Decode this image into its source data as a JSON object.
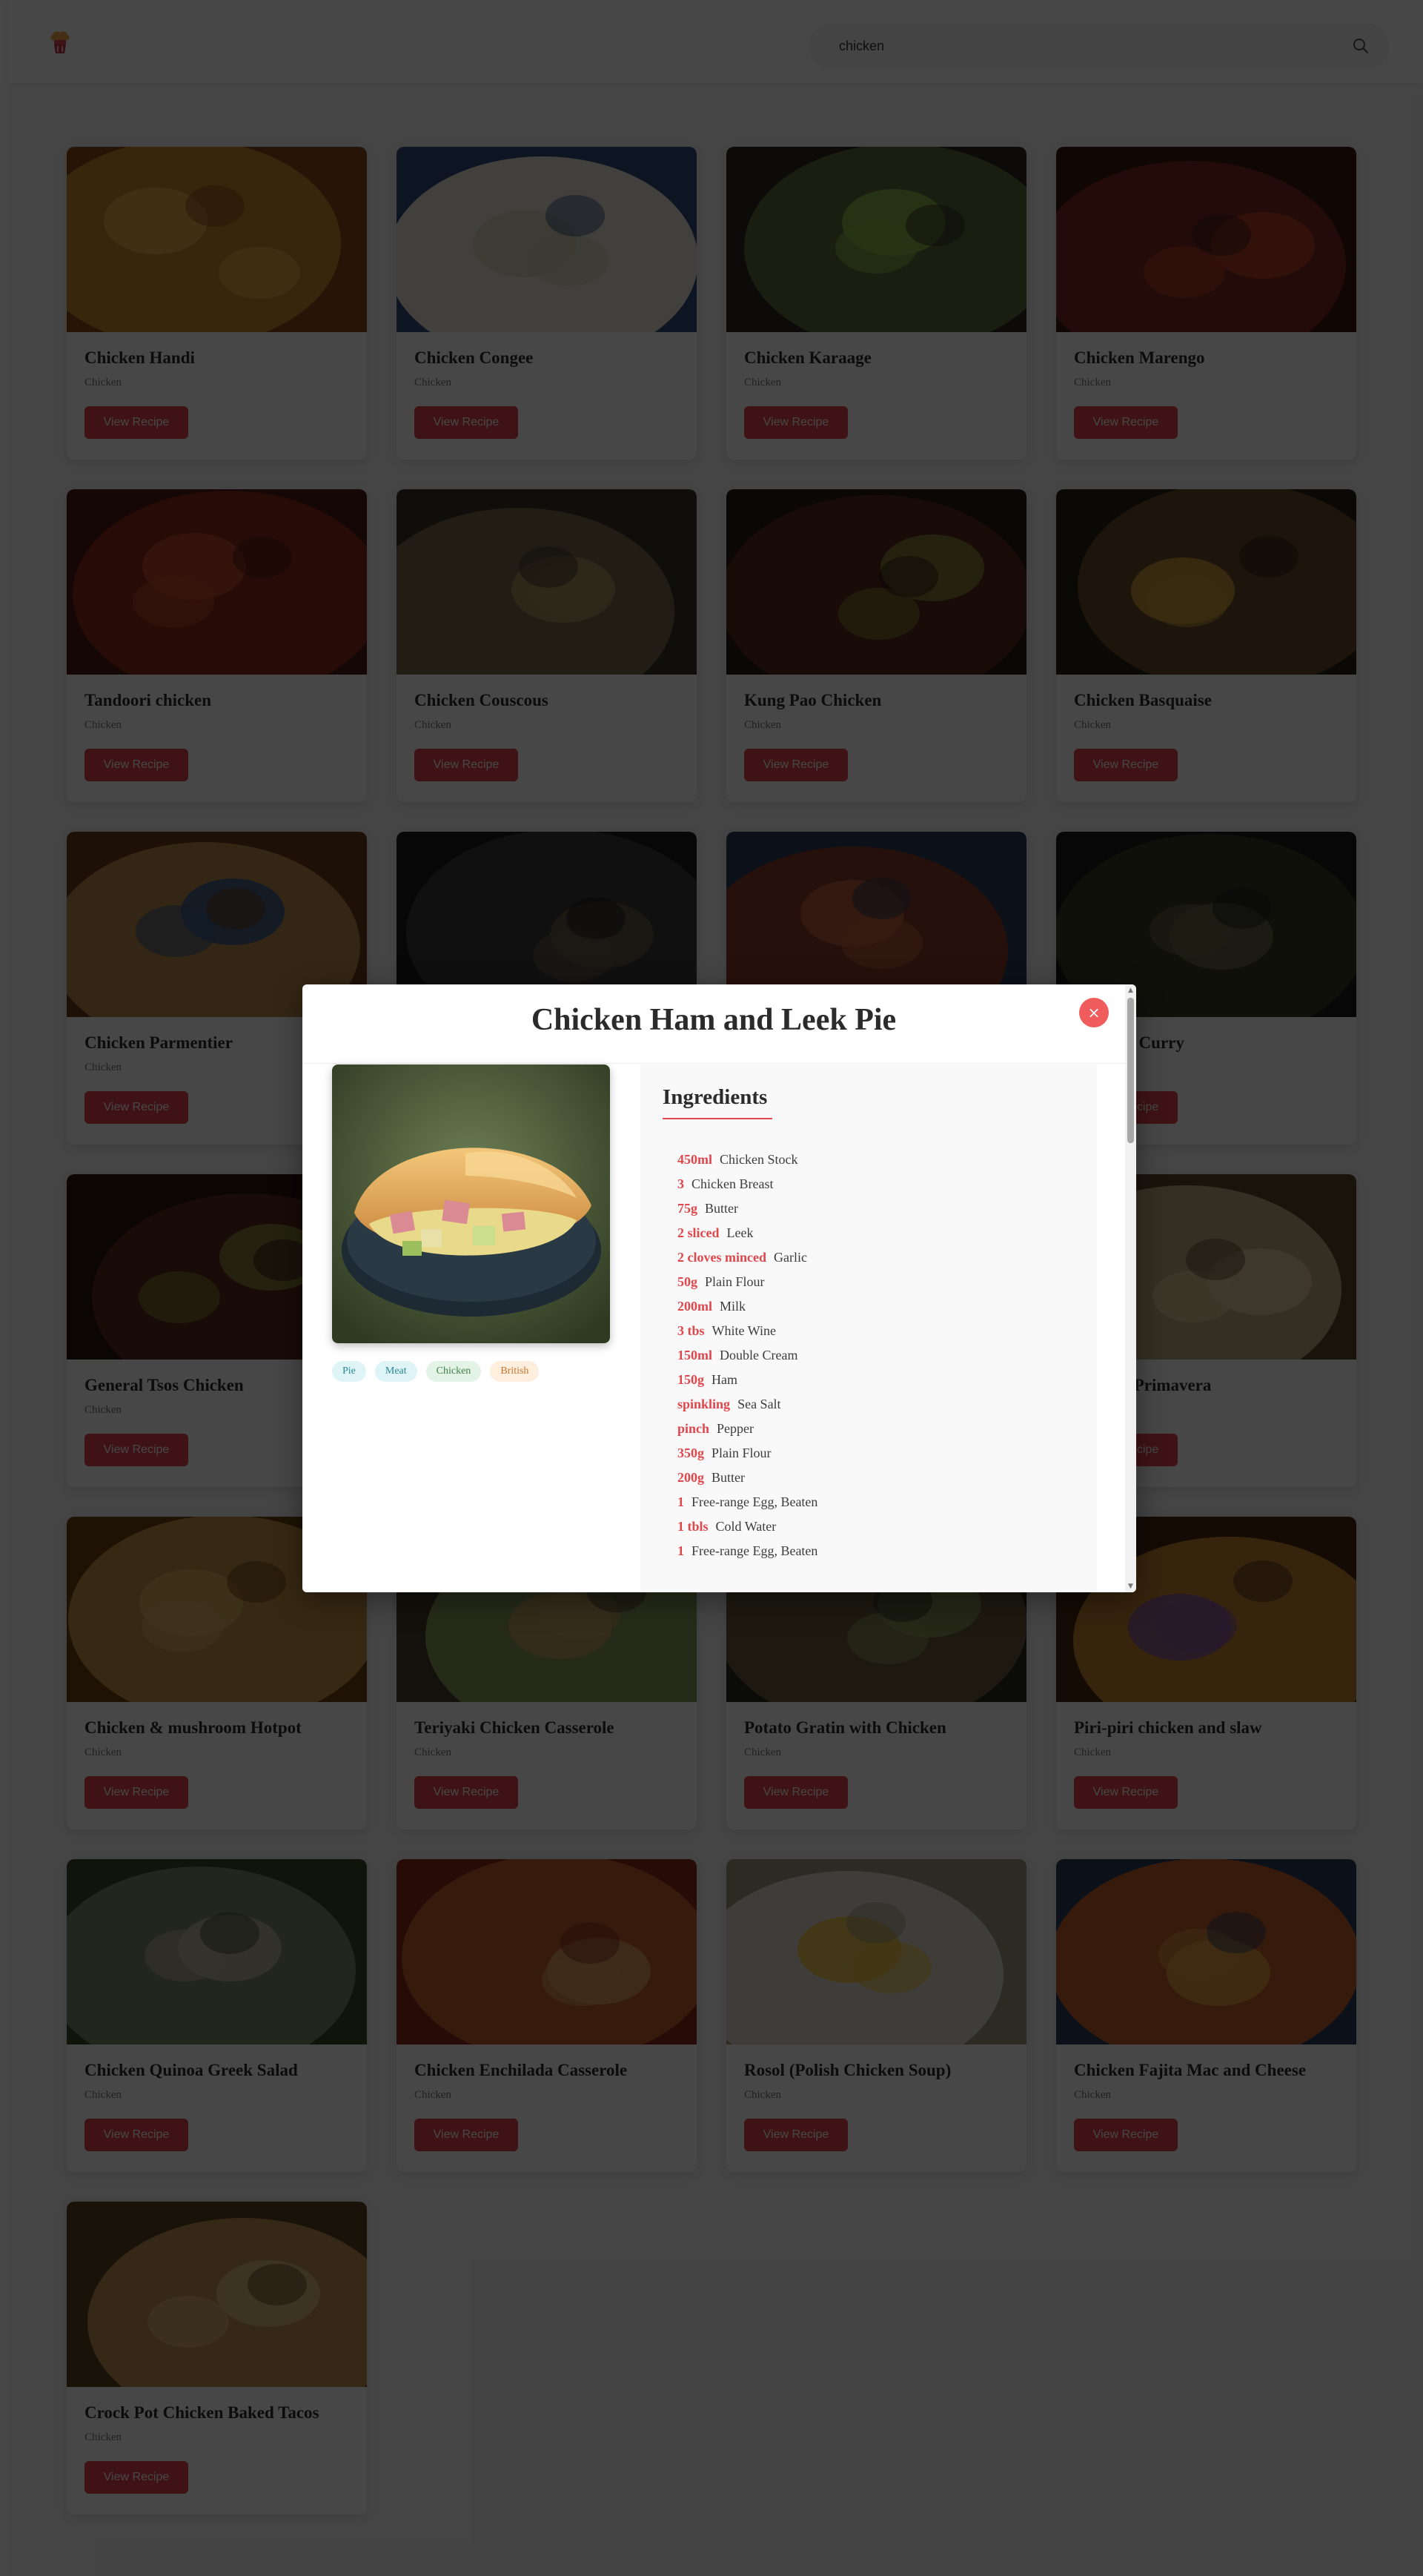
{
  "search": {
    "value": "chicken"
  },
  "recipes": [
    {
      "title": "Chicken Handi",
      "category": "Chicken"
    },
    {
      "title": "Chicken Congee",
      "category": "Chicken"
    },
    {
      "title": "Chicken Karaage",
      "category": "Chicken"
    },
    {
      "title": "Chicken Marengo",
      "category": "Chicken"
    },
    {
      "title": "Tandoori chicken",
      "category": "Chicken"
    },
    {
      "title": "Chicken Couscous",
      "category": "Chicken"
    },
    {
      "title": "Kung Pao Chicken",
      "category": "Chicken"
    },
    {
      "title": "Chicken Basquaise",
      "category": "Chicken"
    },
    {
      "title": "Chicken Parmentier",
      "category": "Chicken"
    },
    {
      "title": "",
      "category": ""
    },
    {
      "title": "",
      "category": ""
    },
    {
      "title": "Chicken Curry",
      "category": ""
    },
    {
      "title": "General Tsos Chicken",
      "category": "Chicken"
    },
    {
      "title": "",
      "category": ""
    },
    {
      "title": "",
      "category": ""
    },
    {
      "title": "Alfredo Primavera",
      "category": ""
    },
    {
      "title": "Chicken & mushroom Hotpot",
      "category": "Chicken"
    },
    {
      "title": "Teriyaki Chicken Casserole",
      "category": "Chicken"
    },
    {
      "title": "Potato Gratin with Chicken",
      "category": "Chicken"
    },
    {
      "title": "Piri-piri chicken and slaw",
      "category": "Chicken"
    },
    {
      "title": "Chicken Quinoa Greek Salad",
      "category": "Chicken"
    },
    {
      "title": "Chicken Enchilada Casserole",
      "category": "Chicken"
    },
    {
      "title": "Rosol (Polish Chicken Soup)",
      "category": "Chicken"
    },
    {
      "title": "Chicken Fajita Mac and Cheese",
      "category": "Chicken"
    },
    {
      "title": "Crock Pot Chicken Baked Tacos",
      "category": "Chicken"
    }
  ],
  "card_button_label": "View Recipe",
  "modal": {
    "title": "Chicken Ham and Leek Pie",
    "close_label": "×",
    "tags": [
      "Pie",
      "Meat",
      "Chicken",
      "British"
    ],
    "ingredients_heading": "Ingredients",
    "ingredients": [
      {
        "qty": "450ml",
        "name": "Chicken Stock"
      },
      {
        "qty": "3",
        "name": "Chicken Breast"
      },
      {
        "qty": "75g",
        "name": "Butter"
      },
      {
        "qty": "2 sliced",
        "name": "Leek"
      },
      {
        "qty": "2 cloves minced",
        "name": "Garlic"
      },
      {
        "qty": "50g",
        "name": "Plain Flour"
      },
      {
        "qty": "200ml",
        "name": "Milk"
      },
      {
        "qty": "3 tbs",
        "name": "White Wine"
      },
      {
        "qty": "150ml",
        "name": "Double Cream"
      },
      {
        "qty": "150g",
        "name": "Ham"
      },
      {
        "qty": "spinkling",
        "name": "Sea Salt"
      },
      {
        "qty": "pinch",
        "name": "Pepper"
      },
      {
        "qty": "350g",
        "name": "Plain Flour"
      },
      {
        "qty": "200g",
        "name": "Butter"
      },
      {
        "qty": "1",
        "name": "Free-range Egg, Beaten"
      },
      {
        "qty": "1 tbls",
        "name": "Cold Water"
      },
      {
        "qty": "1",
        "name": "Free-range Egg, Beaten"
      }
    ]
  },
  "colors": {
    "accent": "#e0474c",
    "overlay": "rgba(0,0,0,0.72)",
    "close_button": "#f05b5b"
  },
  "icons": {
    "logo": "chef-hat-logo-icon",
    "search": "search-icon",
    "close": "close-icon"
  }
}
